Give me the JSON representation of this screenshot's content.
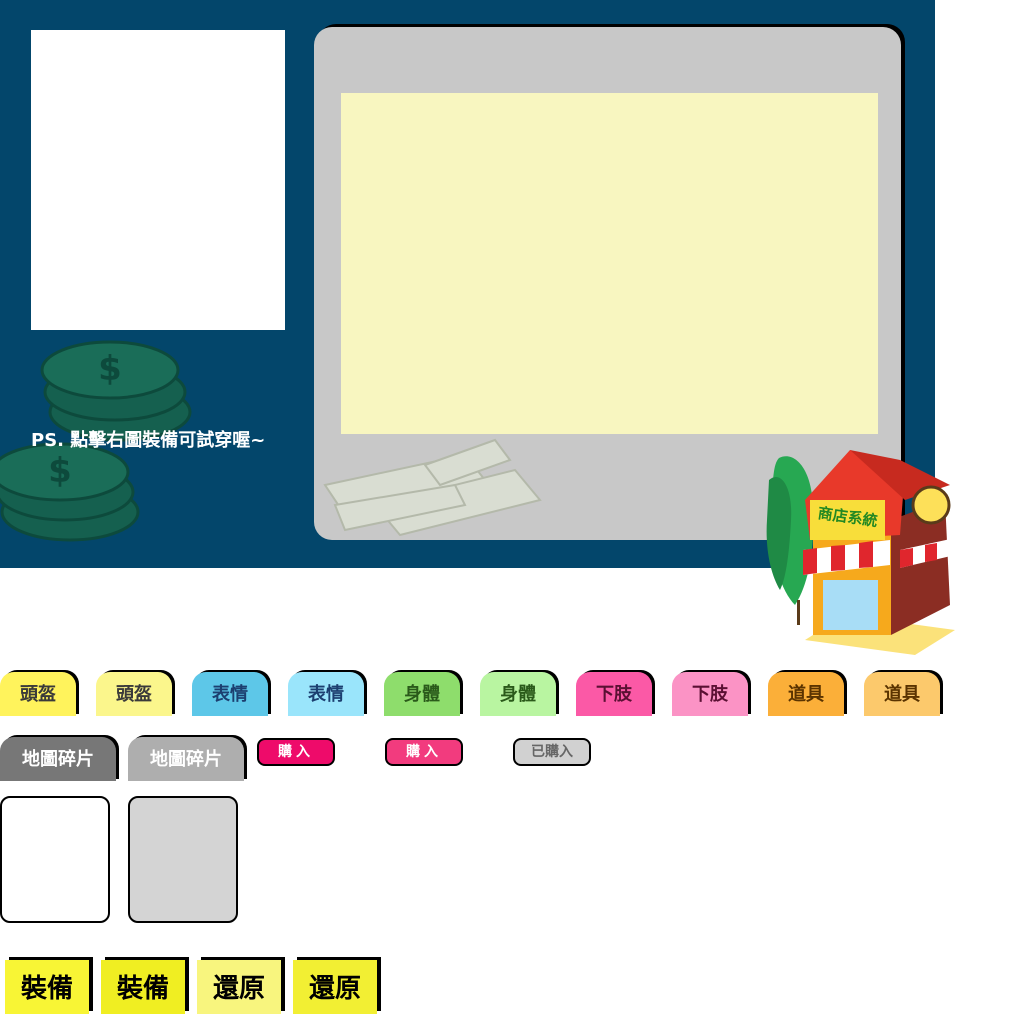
{
  "hint_text": "PS. 點擊右圖裝備可試穿喔~",
  "store_sign": "商店系統",
  "category_tabs": [
    {
      "label": "頭盔",
      "bg": "#fff35c",
      "color": "#3a3a3a"
    },
    {
      "label": "頭盔",
      "bg": "#fbf68c",
      "color": "#3a3a3a"
    },
    {
      "label": "表情",
      "bg": "#5dc7e8",
      "color": "#1c3f70"
    },
    {
      "label": "表情",
      "bg": "#9ae5fb",
      "color": "#1c3f70"
    },
    {
      "label": "身體",
      "bg": "#8edd6c",
      "color": "#2a5a1a"
    },
    {
      "label": "身體",
      "bg": "#b9f5a1",
      "color": "#2a5a1a"
    },
    {
      "label": "下肢",
      "bg": "#fb59a6",
      "color": "#5a1033"
    },
    {
      "label": "下肢",
      "bg": "#fb93c5",
      "color": "#5a1033"
    },
    {
      "label": "道具",
      "bg": "#fbaf39",
      "color": "#5a3300"
    },
    {
      "label": "道具",
      "bg": "#fcc96c",
      "color": "#5a3300"
    }
  ],
  "map_tabs": [
    {
      "label": "地圖碎片",
      "bg": "#777777"
    },
    {
      "label": "地圖碎片",
      "bg": "#aeaeae"
    }
  ],
  "buy_buttons": [
    {
      "label": "購入",
      "bg": "#ee0b6a",
      "color": "#ffffff"
    },
    {
      "label": "購入",
      "bg": "#f23b7e",
      "color": "#ffffff"
    },
    {
      "label": "已購入",
      "bg": "#d1d1d1",
      "color": "#666666"
    }
  ],
  "action_buttons": [
    {
      "label": "裝備",
      "bg": "#f8f535"
    },
    {
      "label": "裝備",
      "bg": "#f0ee22"
    },
    {
      "label": "還原",
      "bg": "#f8f57e"
    },
    {
      "label": "還原",
      "bg": "#f2ef33"
    }
  ],
  "colors": {
    "panel": "#03466b",
    "display_frame": "#c8c8c8",
    "display_screen": "#f8f6c0"
  }
}
